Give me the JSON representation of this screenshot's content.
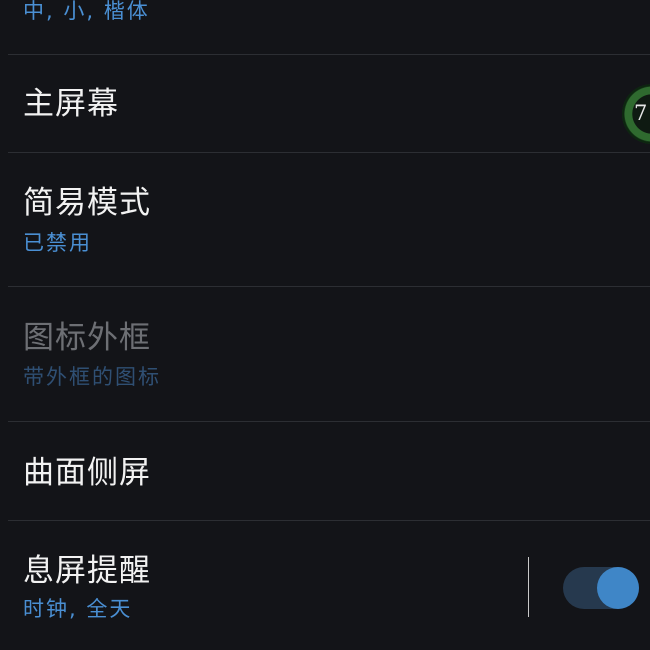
{
  "settings": {
    "font_row": {
      "subtitle": "中, 小, 楷体"
    },
    "home_screen": {
      "title": "主屏幕",
      "badge_text": "7"
    },
    "simple_mode": {
      "title": "简易模式",
      "subtitle": "已禁用"
    },
    "icon_frame": {
      "title": "图标外框",
      "subtitle": "带外框的图标"
    },
    "edge_screen": {
      "title": "曲面侧屏"
    },
    "aod": {
      "title": "息屏提醒",
      "subtitle": "时钟, 全天",
      "toggle_on": true
    }
  },
  "colors": {
    "background": "#131418",
    "accent": "#4a8fd3",
    "toggle_on": "#3f86c7"
  }
}
